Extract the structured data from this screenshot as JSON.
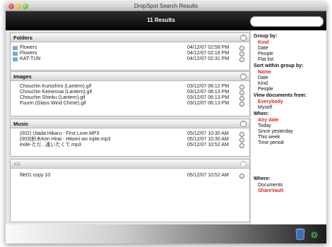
{
  "window": {
    "title": "DropSpot Search Results"
  },
  "toolbar": {
    "results_count": "11 Results",
    "search_value": "",
    "search_placeholder": ""
  },
  "sections": {
    "folders": {
      "title": "Folders",
      "rows": [
        {
          "name": "Flowers",
          "date": "04/12/07 02:58 PM"
        },
        {
          "name": "Flowers",
          "date": "04/12/07 02:16 PM"
        },
        {
          "name": "KAT-TUN",
          "date": "04/12/07 02:31 PM"
        }
      ]
    },
    "images": {
      "title": "Images",
      "rows": [
        {
          "name": "Chouchin Kuroshiro (Lantern).gif",
          "date": "03/12/07 06:12 PM"
        },
        {
          "name": "Chouchin Keinensai (Lantern).gif",
          "date": "03/12/07 06:13 PM"
        },
        {
          "name": "Chouchin Shinku (Lantern).gif",
          "date": "03/12/07 06:13 PM"
        },
        {
          "name": "Fuurin (Glass Wind Chime).gif",
          "date": "03/12/07 06:13 PM"
        }
      ]
    },
    "music": {
      "title": "Music",
      "rows": [
        {
          "name": "(002) Utada Hikaru - First Love.MP3",
          "date": "05/12/07 10:30 AM"
        },
        {
          "name": "(003)鈴木Ken Hirai - Hitomi wo tojite.mp3",
          "date": "05/12/07 10:30 AM"
        },
        {
          "name": "exile-ただ...逢いたくて.mp3",
          "date": "05/12/07 10:52 AM"
        }
      ]
    },
    "all": {
      "title": "All",
      "rows": [
        {
          "name": "file01 copy 10",
          "date": "05/12/07 10:52 AM"
        }
      ]
    }
  },
  "sidebar": {
    "group_by": {
      "heading": "Group by:",
      "items": [
        "Kind",
        "Date",
        "People",
        "Flat list"
      ],
      "active": "Kind"
    },
    "sort_within": {
      "heading": "Sort within group by:",
      "items": [
        "Name",
        "Date",
        "Kind",
        "People"
      ],
      "active": "Name"
    },
    "view_from": {
      "heading": "View documents from:",
      "items": [
        "Everybody",
        "Myself"
      ],
      "active": "Everybody"
    },
    "when": {
      "heading": "When:",
      "items": [
        "Any date",
        "Today",
        "Since yesterday",
        "This week",
        "Time period"
      ],
      "active": "Any date"
    },
    "where": {
      "heading": "Where:",
      "items": [
        "Documents",
        "ShareVault"
      ],
      "active": "ShareVault"
    }
  },
  "colors": {
    "active": "#d62b1e",
    "toolbar": "#0a0a0a",
    "folder": "#7aa7d6"
  },
  "icons": {
    "info": "info-icon",
    "collapse": "collapse-icon",
    "trash": "trash-icon",
    "spinner": "spinner-icon"
  }
}
